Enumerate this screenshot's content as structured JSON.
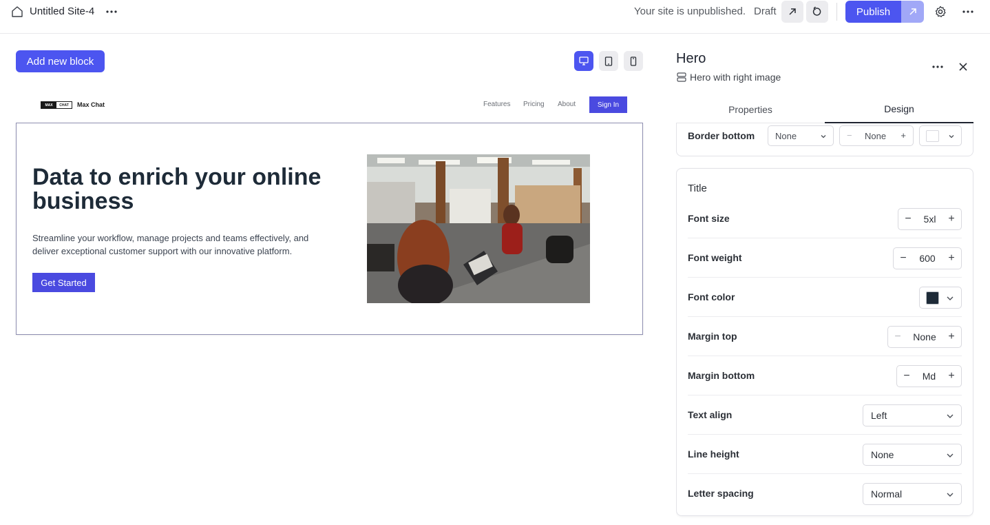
{
  "topbar": {
    "site_name": "Untitled Site-4",
    "status": "Your site is unpublished.",
    "draft_label": "Draft",
    "publish_label": "Publish"
  },
  "canvas": {
    "add_block_label": "Add new block",
    "device_modes": [
      "desktop",
      "tablet",
      "mobile"
    ],
    "active_device": "desktop"
  },
  "site": {
    "logo_left": "MAX",
    "logo_right": "CHAT",
    "brand": "Max Chat",
    "nav": [
      "Features",
      "Pricing",
      "About"
    ],
    "signin_label": "Sign In",
    "hero": {
      "title": "Data to enrich your online business",
      "subtitle": "Streamline your workflow, manage projects and teams effectively, and deliver exceptional customer support with our innovative platform.",
      "cta": "Get Started"
    }
  },
  "panel": {
    "title": "Hero",
    "subtitle": "Hero with right image",
    "tabs": [
      "Properties",
      "Design"
    ],
    "active_tab": "Design",
    "previous_card": {
      "label": "Border bottom",
      "values": [
        "None",
        "None"
      ]
    },
    "section_title": "Title",
    "rows": {
      "font_size": {
        "label": "Font size",
        "value": "5xl"
      },
      "font_weight": {
        "label": "Font weight",
        "value": "600"
      },
      "font_color": {
        "label": "Font color",
        "value": "#1e2b38"
      },
      "margin_top": {
        "label": "Margin top",
        "value": "None"
      },
      "margin_bottom": {
        "label": "Margin bottom",
        "value": "Md"
      },
      "text_align": {
        "label": "Text align",
        "value": "Left"
      },
      "line_height": {
        "label": "Line height",
        "value": "None"
      },
      "letter_spacing": {
        "label": "Letter spacing",
        "value": "Normal"
      }
    }
  },
  "colors": {
    "accent": "#4c55f0",
    "site_accent": "#4a4ae0",
    "title_text": "#1e2b38"
  }
}
